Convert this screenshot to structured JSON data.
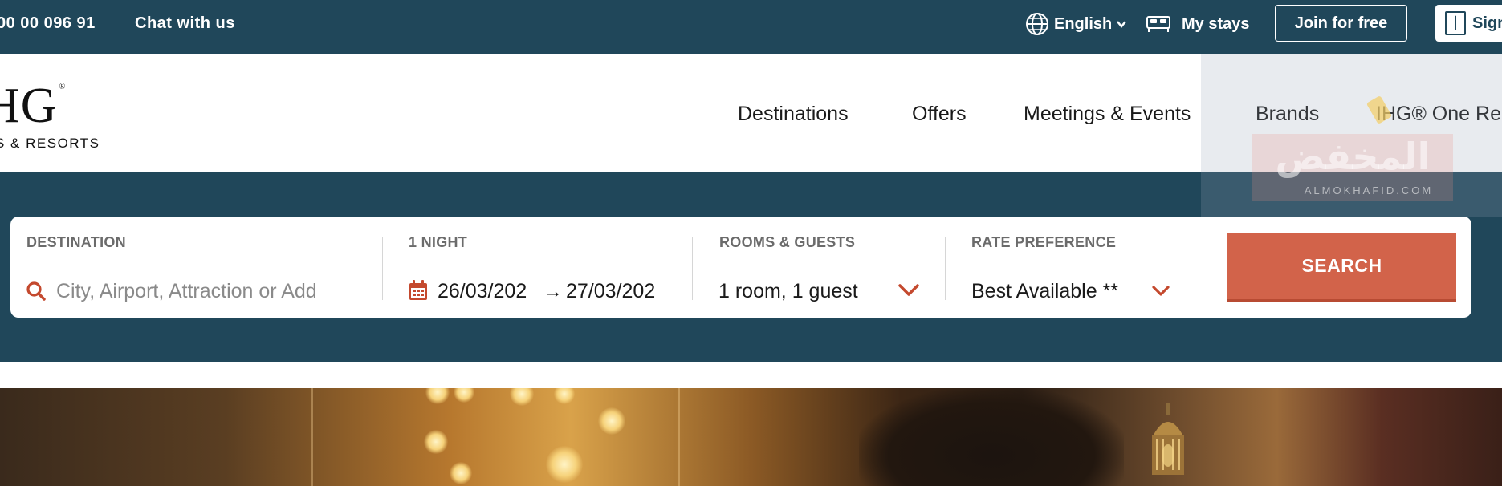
{
  "topbar": {
    "phone": "00 00 096 91",
    "chat_label": "Chat with us",
    "language": "English",
    "my_stays": "My stays",
    "join_label": "Join for free",
    "signin_label": "Sign"
  },
  "header": {
    "logo_main": "HG",
    "logo_sub": "S & RESORTS",
    "nav": [
      "Destinations",
      "Offers",
      "Meetings & Events",
      "Brands",
      "IHG® One Re"
    ]
  },
  "watermark": {
    "text": "المخفض",
    "subtext": "ALMOKHAFID.COM"
  },
  "search": {
    "destination": {
      "label": "DESTINATION",
      "placeholder": "City, Airport, Attraction or Add",
      "value": ""
    },
    "dates": {
      "label": "1 NIGHT",
      "check_in": "26/03/202",
      "check_out": "27/03/202",
      "arrow": "→"
    },
    "rooms": {
      "label": "ROOMS & GUESTS",
      "value": "1 room, 1 guest"
    },
    "rate": {
      "label": "RATE PREFERENCE",
      "value": "Best Available **"
    },
    "button_label": "SEARCH"
  },
  "colors": {
    "brand_dark": "#20475a",
    "accent": "#d2634a",
    "text": "#1a1a1a"
  },
  "icons": [
    "globe-icon",
    "chevron-down-icon",
    "bed-icon",
    "door-icon",
    "search-icon",
    "calendar-icon"
  ]
}
